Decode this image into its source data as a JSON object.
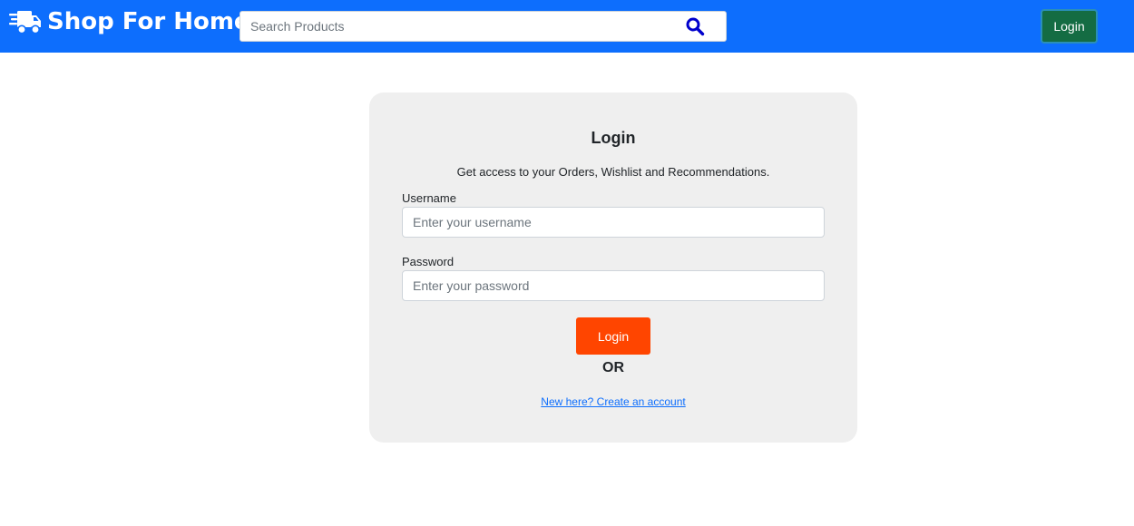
{
  "navbar": {
    "brand": "Shop For Home",
    "brand_icon": "delivery-truck-icon",
    "search": {
      "placeholder": "Search Products",
      "value": "",
      "icon": "search-icon"
    },
    "login_label": "Login",
    "colors": {
      "background": "#0d6efd",
      "login_button": "#146c43",
      "search_icon": "#0000cc"
    }
  },
  "login_card": {
    "title": "Login",
    "subtitle": "Get access to your Orders, Wishlist and Recommendations.",
    "username": {
      "label": "Username",
      "placeholder": "Enter your username",
      "value": ""
    },
    "password": {
      "label": "Password",
      "placeholder": "Enter your password",
      "value": ""
    },
    "submit_label": "Login",
    "or_text": "OR",
    "signup_link": "New here? Create an account",
    "colors": {
      "card_background": "#efefef",
      "submit_button": "#ff4500",
      "link": "#0d6efd"
    }
  }
}
